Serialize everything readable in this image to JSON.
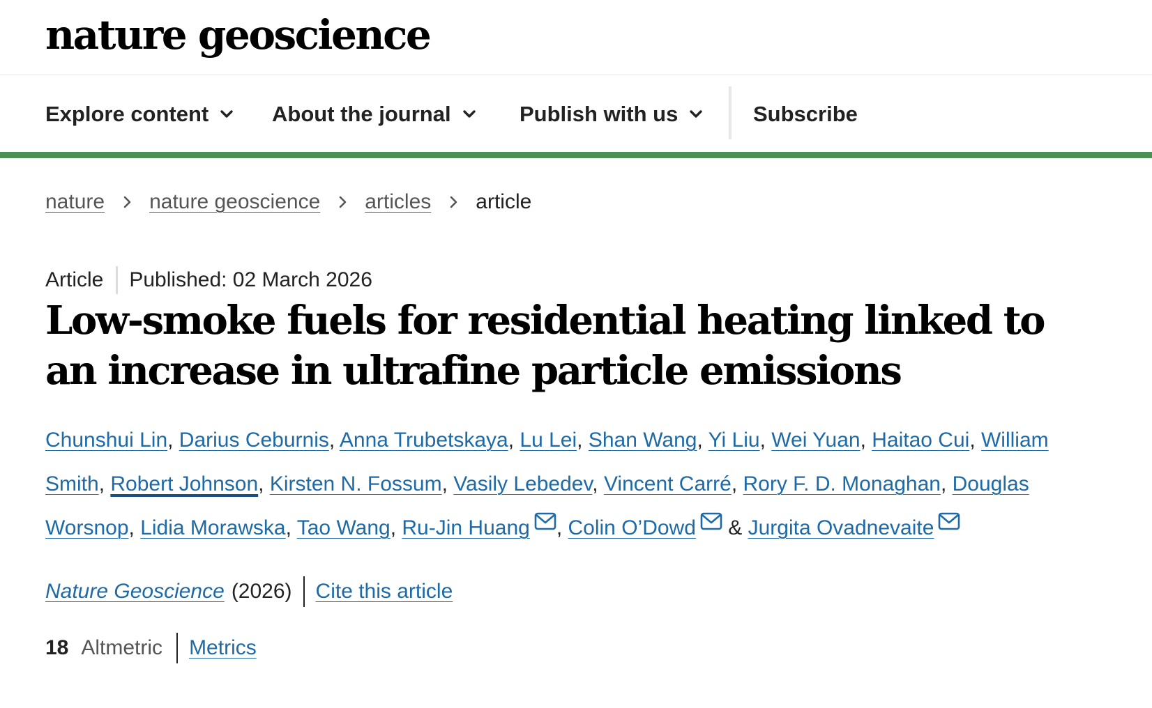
{
  "header": {
    "logo_text": "nature geoscience"
  },
  "nav": {
    "items": [
      {
        "label": "Explore content",
        "has_dropdown": true
      },
      {
        "label": "About the journal",
        "has_dropdown": true
      },
      {
        "label": "Publish with us",
        "has_dropdown": true
      },
      {
        "label": "Subscribe",
        "has_dropdown": false
      }
    ]
  },
  "colors": {
    "accent_rule": "#4d8f55",
    "link": "#1d6aa6",
    "text": "#222222"
  },
  "breadcrumb": {
    "items": [
      "nature",
      "nature geoscience",
      "articles"
    ],
    "current": "article"
  },
  "article": {
    "type": "Article",
    "published": "Published: 02 March 2026",
    "title": "Low-smoke fuels for residential heating linked to an increase in ultrafine particle emissions",
    "authors": [
      "Chunshui Lin",
      "Darius Ceburnis",
      "Anna Trubetskaya",
      "Lu Lei",
      "Shan Wang",
      "Yi Liu",
      "Wei Yuan",
      "Haitao Cui",
      "William Smith",
      "Robert Johnson",
      "Kirsten N. Fossum",
      "Vasily Lebedev",
      "Vincent Carré",
      "Rory F. D. Monaghan",
      "Douglas Worsnop",
      "Lidia Morawska",
      "Tao Wang",
      "Ru-Jin Huang",
      "Colin O’Dowd",
      "Jurgita Ovadnevaite"
    ],
    "author_separator": ", ",
    "author_last_joiner": " & ",
    "journal_name": "Nature Geoscience",
    "year": "(2026)",
    "cite_label": "Cite this article",
    "altmetric_score": "18",
    "altmetric_label": "Altmetric",
    "metrics_label": "Metrics"
  },
  "icons": {
    "nav_chevron": "chevron-down-icon",
    "breadcrumb_sep": "chevron-right-icon",
    "corresponding_author": "mail-icon"
  }
}
